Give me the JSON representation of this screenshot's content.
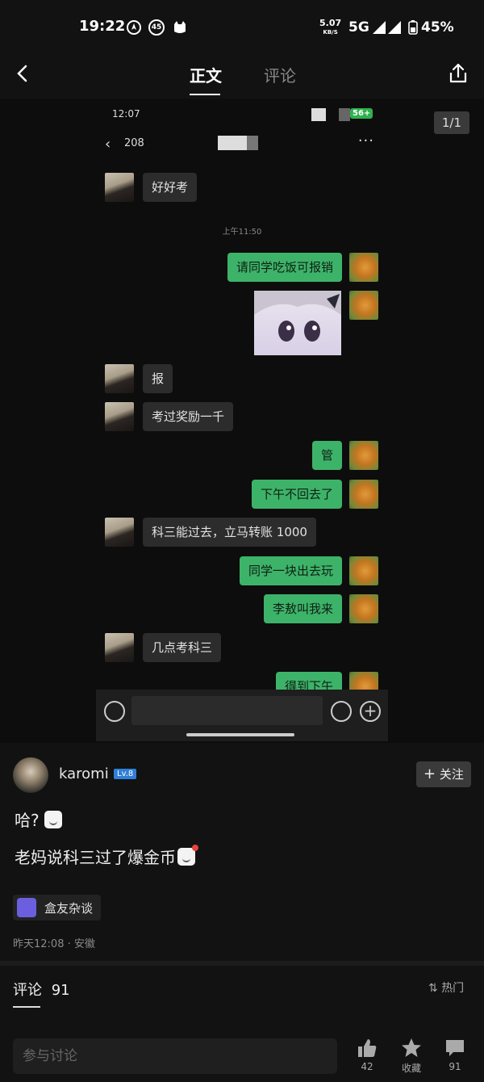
{
  "status_bar": {
    "time": "19:22",
    "notification_badge": "45",
    "speed_value": "5.07",
    "speed_unit": "KB/S",
    "network": "5G",
    "battery": "45%"
  },
  "nav": {
    "tab_main": "正文",
    "tab_comments": "评论"
  },
  "screenshot": {
    "counter": "1/1",
    "inner_time": "12:07",
    "inner_badge": "56+",
    "chat_back_count": "208",
    "more": "···",
    "timestamp": "上午11:50",
    "messages": [
      {
        "side": "left",
        "text": "好好考"
      },
      {
        "side": "right",
        "text": "请同学吃饭可报销"
      },
      {
        "side": "left",
        "text": "报"
      },
      {
        "side": "left",
        "text": "考过奖励一千"
      },
      {
        "side": "right",
        "text": "管"
      },
      {
        "side": "right",
        "text": "下午不回去了"
      },
      {
        "side": "left",
        "text": "科三能过去，立马转账 1000"
      },
      {
        "side": "right",
        "text": "同学一块出去玩"
      },
      {
        "side": "right",
        "text": "李敖叫我来"
      },
      {
        "side": "left",
        "text": "几点考科三"
      },
      {
        "side": "right",
        "text": "得到下午"
      }
    ]
  },
  "post": {
    "author": "karomi",
    "level": "Lv.8",
    "follow_label": "关注",
    "line1": "哈?",
    "line2": "老妈说科三过了爆金币",
    "topic": "盒友杂谈",
    "meta": "昨天12:08 · 安徽"
  },
  "comments": {
    "heading": "评论",
    "count": "91",
    "sort": "热门"
  },
  "bottom": {
    "input_placeholder": "参与讨论",
    "like_count": "42",
    "favorite_label": "收藏",
    "comment_count": "91"
  }
}
